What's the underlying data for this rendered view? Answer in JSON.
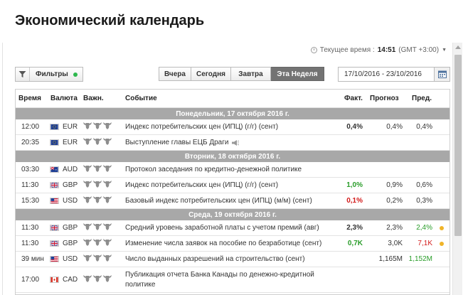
{
  "page": {
    "title": "Экономический календарь"
  },
  "time": {
    "label": "Текущее время :",
    "value": "14:51",
    "tz": "(GMT +3:00)"
  },
  "filters": {
    "label": "Фильтры",
    "status_color": "#2db84d"
  },
  "periods": [
    {
      "label": "Вчера",
      "active": false
    },
    {
      "label": "Сегодня",
      "active": false
    },
    {
      "label": "Завтра",
      "active": false
    },
    {
      "label": "Эта Неделя",
      "active": true
    }
  ],
  "date_range": {
    "value": "17/10/2016 - 23/10/2016"
  },
  "columns": {
    "time": "Время",
    "currency": "Валюта",
    "importance": "Важн.",
    "event": "Событие",
    "actual": "Факт.",
    "forecast": "Прогноз",
    "previous": "Пред."
  },
  "days": {
    "mon": "Понедельник, 17 октября 2016 г.",
    "tue": "Вторник, 18 октября 2016 г.",
    "wed": "Среда, 19 октября 2016 г."
  },
  "events": [
    {
      "time": "12:00",
      "currency": "EUR",
      "flag": "eu",
      "event": "Индекс потребительских цен (ИПЦ) (г/г) (сент)",
      "actual": "0,4%",
      "actual_color": "black",
      "forecast": "0,4%",
      "previous": "0,4%",
      "previous_color": "black",
      "dot": false,
      "speech": false
    },
    {
      "time": "20:35",
      "currency": "EUR",
      "flag": "eu",
      "event": "Выступление главы ЕЦБ Драги",
      "actual": "",
      "actual_color": "black",
      "forecast": "",
      "previous": "",
      "previous_color": "black",
      "dot": false,
      "speech": true
    },
    {
      "time": "03:30",
      "currency": "AUD",
      "flag": "au",
      "event": "Протокол заседания по кредитно-денежной политике",
      "actual": "",
      "actual_color": "black",
      "forecast": "",
      "previous": "",
      "previous_color": "black",
      "dot": false,
      "speech": false
    },
    {
      "time": "11:30",
      "currency": "GBP",
      "flag": "gb",
      "event": "Индекс потребительских цен (ИПЦ) (г/г) (сент)",
      "actual": "1,0%",
      "actual_color": "green",
      "forecast": "0,9%",
      "previous": "0,6%",
      "previous_color": "black",
      "dot": false,
      "speech": false
    },
    {
      "time": "15:30",
      "currency": "USD",
      "flag": "us",
      "event": "Базовый индекс потребительских цен (ИПЦ) (м/м) (сент)",
      "actual": "0,1%",
      "actual_color": "red",
      "forecast": "0,2%",
      "previous": "0,3%",
      "previous_color": "black",
      "dot": false,
      "speech": false
    },
    {
      "time": "11:30",
      "currency": "GBP",
      "flag": "gb",
      "event": "Средний уровень заработной платы с учетом премий (авг)",
      "actual": "2,3%",
      "actual_color": "black",
      "forecast": "2,3%",
      "previous": "2,4%",
      "previous_color": "green",
      "dot": true,
      "speech": false
    },
    {
      "time": "11:30",
      "currency": "GBP",
      "flag": "gb",
      "event": "Изменение числа заявок на пособие по безработице (сент)",
      "actual": "0,7K",
      "actual_color": "green",
      "forecast": "3,0K",
      "previous": "7,1K",
      "previous_color": "red",
      "dot": true,
      "speech": false
    },
    {
      "time": "39 мин",
      "currency": "USD",
      "flag": "us",
      "event": "Число выданных разрешений на строительство (сент)",
      "actual": "",
      "actual_color": "black",
      "forecast": "1,165M",
      "previous": "1,152M",
      "previous_color": "green",
      "dot": false,
      "speech": false
    },
    {
      "time": "17:00",
      "currency": "CAD",
      "flag": "ca",
      "event": "Публикация отчета Банка Канады по денежно-кредитной",
      "event2": "политике",
      "actual": "",
      "actual_color": "black",
      "forecast": "",
      "previous": "",
      "previous_color": "black",
      "dot": false,
      "speech": false
    }
  ]
}
